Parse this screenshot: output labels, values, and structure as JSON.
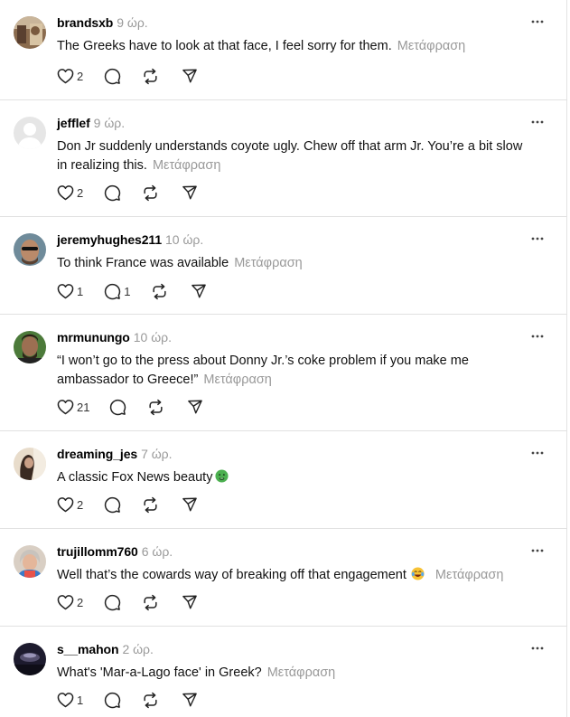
{
  "translate_label": "Μετάφραση",
  "posts": [
    {
      "username": "brandsxb",
      "time": "9 ώρ.",
      "text": "The Greeks have to look at that face, I feel sorry for them.",
      "likes": "2",
      "replies": "",
      "avatar": "avatar-brandsxb"
    },
    {
      "username": "jefflef",
      "time": "9 ώρ.",
      "text": "Don Jr suddenly understands coyote ugly. Chew off that arm Jr. You’re a bit slow in realizing this.",
      "likes": "2",
      "replies": "",
      "avatar": "avatar-default"
    },
    {
      "username": "jeremyhughes211",
      "time": "10 ώρ.",
      "text": "To think France was available",
      "likes": "1",
      "replies": "1",
      "avatar": "avatar-jeremyhughes211"
    },
    {
      "username": "mrmunungo",
      "time": "10 ώρ.",
      "text": "“I won’t go to the press about Donny Jr.’s coke problem if you make me ambassador to Greece!”",
      "likes": "21",
      "replies": "",
      "avatar": "avatar-mrmunungo"
    },
    {
      "username": "dreaming_jes",
      "time": "7 ώρ.",
      "text": "A classic Fox News beauty",
      "likes": "2",
      "replies": "",
      "emoji": "nauseated-face-emoji",
      "avatar": "avatar-dreaming_jes"
    },
    {
      "username": "trujillomm760",
      "time": "6 ώρ.",
      "text": "Well that’s the cowards way of breaking off that engagement",
      "likes": "2",
      "replies": "",
      "emoji": "laughing-tears-emoji",
      "avatar": "avatar-trujillomm760"
    },
    {
      "username": "s__mahon",
      "time": "2 ώρ.",
      "text": "What's 'Mar-a-Lago face' in Greek?",
      "likes": "1",
      "replies": "",
      "avatar": "avatar-s__mahon"
    }
  ],
  "icons": {
    "like": "heart-icon",
    "reply": "comment-icon",
    "repost": "repost-icon",
    "share": "send-icon",
    "more": "more-horizontal-icon"
  },
  "colors": {
    "text": "#000000",
    "muted": "#999999",
    "divider": "#e1e1e1"
  }
}
